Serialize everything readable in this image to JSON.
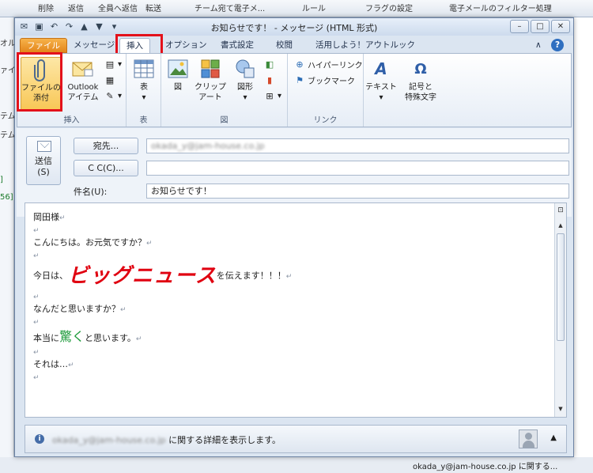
{
  "background": {
    "ribbon_items": [
      "削除",
      "返信",
      "全員へ返信",
      "転送",
      "チーム宛て電子メ...",
      "ルール",
      "フラグの設定",
      "電子メールのフィルター処理"
    ],
    "left_items": [
      "オル",
      "ァイル",
      "テム",
      "テム",
      "]",
      "56]"
    ],
    "status": "okada_y@jam-house.co.jp に関する..."
  },
  "window": {
    "title": "お知らせです！ - メッセージ (HTML 形式)",
    "qat": [
      "save-icon",
      "undo-icon",
      "redo-icon",
      "up-icon",
      "down-icon"
    ]
  },
  "tabs": [
    "ファイル",
    "メッセージ",
    "挿入",
    "オプション",
    "書式設定",
    "校閲",
    "活用しよう！アウトルック"
  ],
  "ribbon": {
    "attach_file": "ファイルの\n添付",
    "outlook_item": "Outlook\nアイテム",
    "group_insert": "挿入",
    "table": "表",
    "group_table": "表",
    "picture": "図",
    "clipart": "クリップ\nアート",
    "shapes": "図形",
    "group_picture": "図",
    "hyperlink": "ハイパーリンク",
    "bookmark": "ブックマーク",
    "group_link": "リンク",
    "text": "テキスト",
    "symbols": "記号と\n特殊文字"
  },
  "header": {
    "send": "送信\n(S)",
    "to_button": "宛先...",
    "cc_button": "C C(C)...",
    "to_value": "okada_y@jam-house.co.jp",
    "cc_value": "",
    "subject_label": "件名(U):",
    "subject_value": "お知らせです！"
  },
  "body": {
    "line1": "岡田様",
    "line2": "こんにちは。お元気ですか？",
    "line3_pre": "今日は、",
    "line3_big": "ビッグニュース",
    "line3_post": "を伝えます！！！",
    "line4": "なんだと思いますか？",
    "line5_pre": "本当に",
    "line5_green": "驚く",
    "line5_post": "と思います。",
    "line6": "それは…",
    "para_mark": "↵"
  },
  "people_pane": {
    "text_blur": "okada_y@jam-house.co.jp",
    "text": "に関する詳細を表示します。"
  },
  "colors": {
    "accent_red": "#e3111b",
    "file_tab": "#e3861b",
    "green": "#1f9b3c"
  }
}
